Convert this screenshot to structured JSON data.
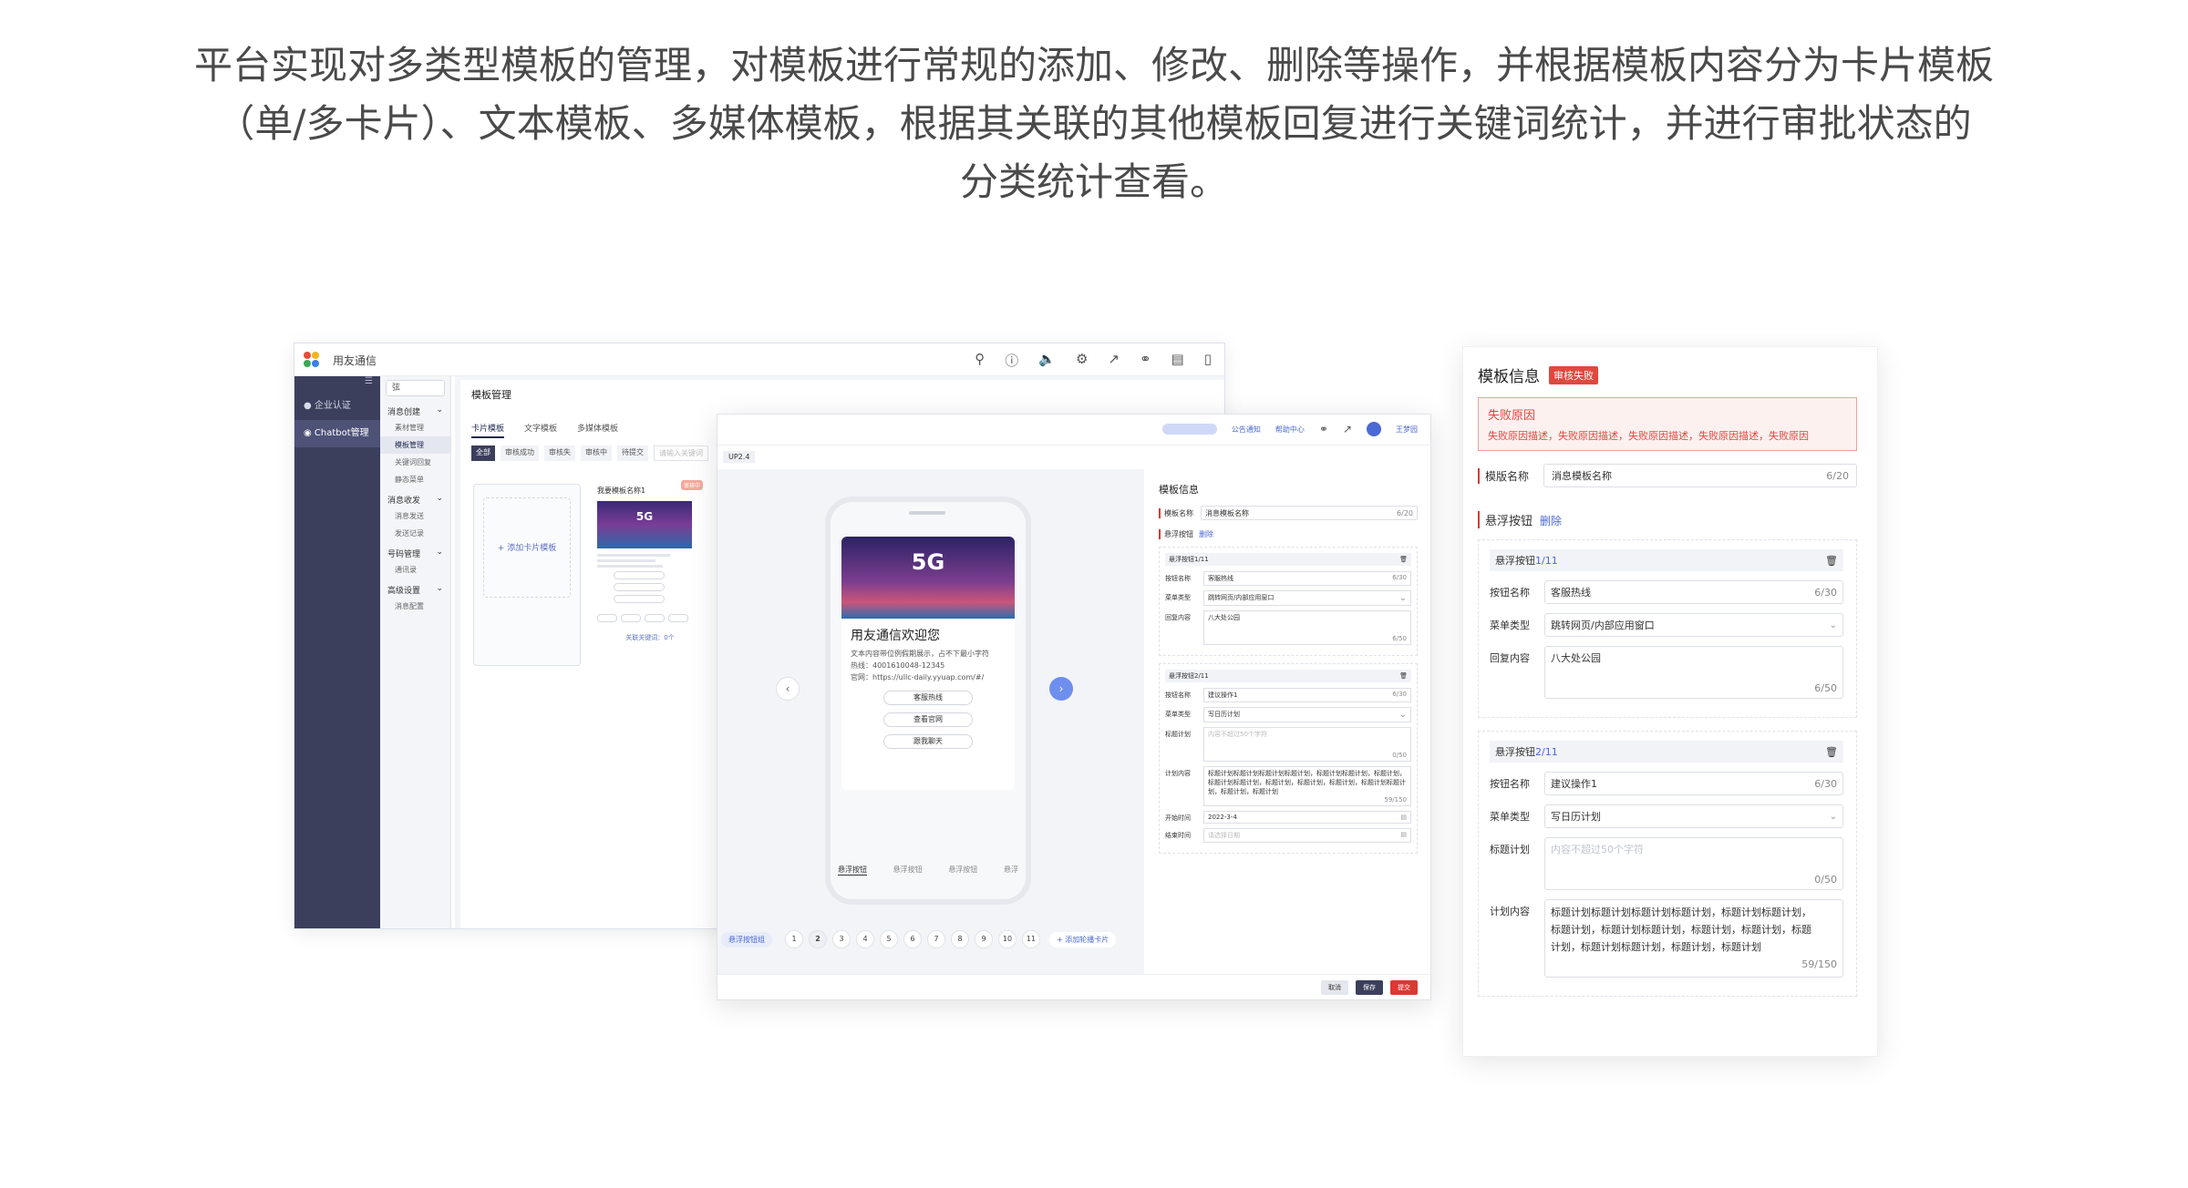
{
  "intro": {
    "line1": "平台实现对多类型模板的管理，对模板进行常规的添加、修改、删除等操作，并根据模板内容分为卡片模板",
    "line2": "（单/多卡片）、文本模板、多媒体模板，根据其关联的其他模板回复进行关键词统计，并进行审批状态的",
    "line3": "分类统计查看。"
  },
  "admin": {
    "app_name": "用友通信",
    "sidebar": [
      {
        "label": "企业认证"
      },
      {
        "label": "Chatbot管理"
      }
    ],
    "menu_search": "弦",
    "menu": {
      "group1": "消息创建",
      "group1_items": [
        "素材管理",
        "模板管理",
        "关键词回复",
        "静态菜单"
      ],
      "group2": "消息收发",
      "group2_items": [
        "消息发送",
        "发送记录"
      ],
      "group3": "号码管理",
      "group3_items": [
        "通讯录"
      ],
      "group4": "高级设置",
      "group4_items": [
        "消息配置"
      ]
    },
    "page_title": "模板管理",
    "tabs": [
      "卡片模板",
      "文字模板",
      "多媒体模板"
    ],
    "filters": [
      "全部",
      "审核成功",
      "审核失",
      "审核中",
      "待提交",
      "请输入关键词"
    ],
    "add_card": "+ 添加卡片模板",
    "template": {
      "name": "我要模板名称1",
      "badge": "审核中",
      "image_text": "5G",
      "keywords": "关联关键词：0个"
    }
  },
  "editor": {
    "version": "UP2.4",
    "top_links": [
      "公告通知",
      "帮助中心",
      "王梦园"
    ],
    "phone": {
      "image_text": "5G",
      "title": "用友通信欢迎您",
      "text_lines": [
        "文本内容带位例假期展示，占不下最小字符",
        "热线：4001610048-12345",
        "官网：https://ullc-daily.yyuap.com/#/"
      ],
      "buttons": [
        "客服热线",
        "查看官网",
        "跟我聊天"
      ],
      "menu": [
        "悬浮按钮",
        "悬浮按钮",
        "悬浮按钮",
        "悬浮"
      ]
    },
    "pager": {
      "float_btn": "悬浮按钮组",
      "pages": [
        "1",
        "2",
        "3",
        "4",
        "5",
        "6",
        "7",
        "8",
        "9",
        "10",
        "11"
      ],
      "active_page": "2",
      "add": "+ 添加轮播卡片"
    },
    "form": {
      "title": "模板信息",
      "name_label": "模板名称",
      "name_value": "消息模板名称",
      "name_count": "6/20",
      "float_label": "悬浮按钮",
      "delete": "删除",
      "box1": {
        "head": "悬浮按钮1/11",
        "btn_name_label": "按钮名称",
        "btn_name_value": "客服热线",
        "btn_name_count": "6/30",
        "menu_type_label": "菜单类型",
        "menu_type_value": "跳转网页/内部应用窗口",
        "reply_label": "回复内容",
        "reply_value": "八大处公园",
        "reply_count": "6/50"
      },
      "box2": {
        "head": "悬浮按钮2/11",
        "btn_name_label": "按钮名称",
        "btn_name_value": "建议操作1",
        "btn_name_count": "6/30",
        "menu_type_label": "菜单类型",
        "menu_type_value": "写日历计划",
        "plan_title_label": "标题计划",
        "plan_title_placeholder": "内容不超过50个字符",
        "plan_title_count": "0/50",
        "plan_content_label": "计划内容",
        "plan_content_value": "标题计划标题计划标题计划标题计划，标题计划标题计划，标题计划，标题计划标题计划，标题计划，标题计划，标题计划，标题计划标题计划，标题计划，标题计划",
        "plan_content_count": "59/150",
        "start_label": "开始时间",
        "start_value": "2022-3-4",
        "end_label": "结束时间",
        "end_placeholder": "请选择日期"
      },
      "buttons": [
        "取消",
        "保存",
        "提交"
      ]
    }
  },
  "panel": {
    "title": "模板信息",
    "status_badge": "审核失败",
    "fail_title": "失败原因",
    "fail_desc": "失败原因描述，失败原因描述，失败原因描述，失败原因描述，失败原因",
    "name_label": "模版名称",
    "name_value": "消息模板名称",
    "name_count": "6/20",
    "float_label": "悬浮按钮",
    "delete": "删除",
    "box1": {
      "head_prefix": "悬浮按钮",
      "head_num": "1/11",
      "btn_name_label": "按钮名称",
      "btn_name_value": "客服热线",
      "btn_name_count": "6/30",
      "menu_type_label": "菜单类型",
      "menu_type_value": "跳转网页/内部应用窗口",
      "reply_label": "回复内容",
      "reply_value": "八大处公园",
      "reply_count": "6/50"
    },
    "box2": {
      "head_prefix": "悬浮按钮",
      "head_num": "2/11",
      "btn_name_label": "按钮名称",
      "btn_name_value": "建议操作1",
      "btn_name_count": "6/30",
      "menu_type_label": "菜单类型",
      "menu_type_value": "写日历计划",
      "plan_title_label": "标题计划",
      "plan_title_placeholder": "内容不超过50个字符",
      "plan_title_count": "0/50",
      "plan_content_label": "计划内容",
      "plan_content_line1": "标题计划标题计划标题计划标题计划，标题计划标题计划，",
      "plan_content_line2": "标题计划，标题计划标题计划，标题计划，标题计划，标题",
      "plan_content_line3": "计划，标题计划标题计划，标题计划，标题计划",
      "plan_content_count": "59/150"
    }
  },
  "colors": {
    "sidebar": "#3b3f5c",
    "accent_blue": "#4b68d4",
    "error_red": "#e0483d"
  }
}
